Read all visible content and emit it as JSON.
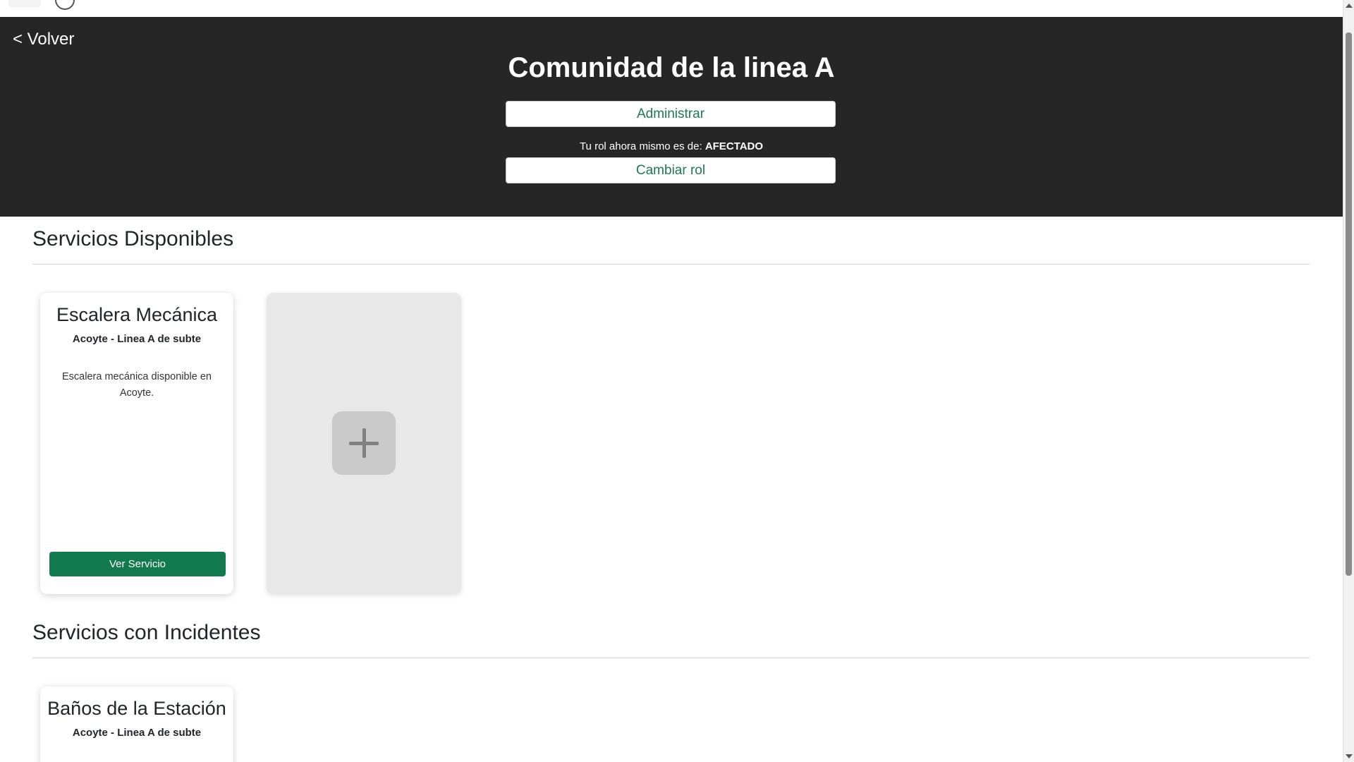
{
  "nav": {
    "brand": "",
    "extra": ""
  },
  "hero": {
    "back_label": "< Volver",
    "title": "Comunidad de la linea A",
    "admin_button": "Administrar",
    "role_prefix": "Tu rol ahora mismo es de:",
    "role_value": "AFECTADO",
    "change_role_button": "Cambiar rol"
  },
  "sections": {
    "available": {
      "title": "Servicios Disponibles",
      "cards": [
        {
          "title": "Escalera Mecánica",
          "subtitle": "Acoyte - Linea A de subte",
          "description": "Escalera mecánica disponible en Acoyte.",
          "button": "Ver Servicio"
        }
      ],
      "add_card_icon": "plus-icon"
    },
    "incidents": {
      "title": "Servicios con Incidentes",
      "cards": [
        {
          "title": "Baños de la Estación",
          "subtitle": "Acoyte - Linea A de subte"
        }
      ]
    }
  },
  "colors": {
    "hero_bg": "#262626",
    "accent_green": "#137a50",
    "button_text_green": "#1d7a4f"
  }
}
